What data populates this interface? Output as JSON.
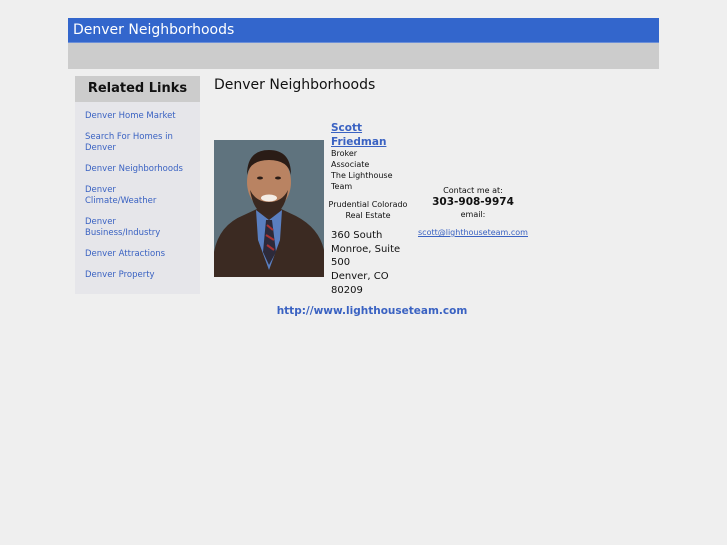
{
  "header": {
    "title": "Denver Neighborhoods"
  },
  "sidebar": {
    "title": "Related Links",
    "items": [
      {
        "label": "Denver Home Market"
      },
      {
        "label": "Search For Homes in Denver"
      },
      {
        "label": "Denver Neighborhoods"
      },
      {
        "label": "Denver Climate/Weather"
      },
      {
        "label": "Denver Business/Industry"
      },
      {
        "label": "Denver Attractions"
      },
      {
        "label": "Denver Property"
      }
    ]
  },
  "main": {
    "title": "Denver Neighborhoods",
    "agent": {
      "photo_alt": "Scott Friedman headshot",
      "name": "Scott Friedman",
      "title_lines": [
        "Broker",
        "Associate",
        "The Lighthouse",
        "Team"
      ],
      "company": "Prudential Colorado Real Estate",
      "address_lines": [
        "360 South",
        "Monroe, Suite",
        "500",
        "Denver, CO",
        "80209"
      ]
    },
    "contact": {
      "label": "Contact me at:",
      "phone": "303-908-9974",
      "email_label": "email:",
      "email": "scott@lighthouseteam.com"
    },
    "website": "http://www.lighthouseteam.com"
  },
  "colors": {
    "header_bg": "#3366cc",
    "subbar_bg": "#cccccc",
    "sidebar_bg": "#e6e6ea",
    "link": "#3a62c2",
    "page_bg": "#efefef"
  }
}
